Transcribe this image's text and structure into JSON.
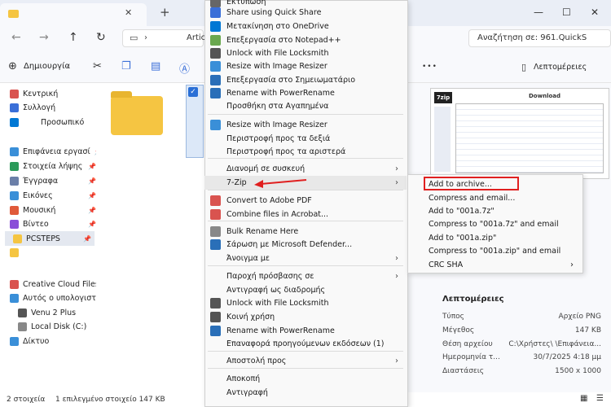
{
  "window": {
    "new_tab_icon": "plus-icon",
    "minimize": "—",
    "maximize": "☐",
    "close": "✕"
  },
  "address": {
    "folder": "Artic",
    "search_placeholder": "Αναζήτηση σε: 961.QuickS"
  },
  "toolbar": {
    "create_label": "Δημιουργία",
    "more": "•••",
    "details_label": "Λεπτομέρειες"
  },
  "sidebar": {
    "items": [
      {
        "label": "Κεντρική",
        "color": "#d9534f"
      },
      {
        "label": "Συλλογή",
        "color": "#3a6fd8"
      },
      {
        "label": "Προσωπικό",
        "color": "#0078d4"
      },
      {
        "label": "Επιφάνεια εργασί",
        "color": "#3a8fd8"
      },
      {
        "label": "Στοιχεία λήψης",
        "color": "#2b9a5a"
      },
      {
        "label": "Έγγραφα",
        "color": "#6b7fa8"
      },
      {
        "label": "Εικόνες",
        "color": "#3a8fd8"
      },
      {
        "label": "Μουσική",
        "color": "#e05a3a"
      },
      {
        "label": "Βίντεο",
        "color": "#8a4fd8"
      },
      {
        "label": "PCSTEPS",
        "color": "#f5c542"
      },
      {
        "label": "",
        "color": "#f5c542"
      },
      {
        "label": "Creative Cloud Files F",
        "color": "#d9534f"
      },
      {
        "label": "Αυτός ο υπολογιστή",
        "color": "#3a8fd8"
      },
      {
        "label": "Venu 2 Plus",
        "color": "#555555"
      },
      {
        "label": "Local Disk (C:)",
        "color": "#888888"
      },
      {
        "label": "Δίκτυο",
        "color": "#3a8fd8"
      }
    ]
  },
  "context_menu": {
    "items": [
      {
        "label": "Εκτύπωση",
        "icon": "printer-icon",
        "color": "#666666"
      },
      {
        "label": "Share using Quick Share",
        "icon": "share-icon",
        "color": "#3a6fd8"
      },
      {
        "label": "Μετακίνηση στο OneDrive",
        "icon": "cloud-icon",
        "color": "#0078d4"
      },
      {
        "label": "Επεξεργασία στο Notepad++",
        "icon": "notepad-icon",
        "color": "#6aa84f"
      },
      {
        "label": "Unlock with File Locksmith",
        "icon": "lock-icon",
        "color": "#555555"
      },
      {
        "label": "Resize with Image Resizer",
        "icon": "resize-icon",
        "color": "#3a8fd8"
      },
      {
        "label": "Επεξεργασία στο Σημειωματάριο",
        "icon": "notepad-icon",
        "color": "#2a6fb8"
      },
      {
        "label": "Rename with PowerRename",
        "icon": "rename-icon",
        "color": "#2a6fb8"
      },
      {
        "label": "Προσθήκη στα Αγαπημένα",
        "icon": "",
        "color": ""
      },
      {
        "label": "Resize with Image Resizer",
        "icon": "resize-icon",
        "color": "#3a8fd8"
      },
      {
        "label": "Περιστροφή προς τα δεξιά",
        "icon": "",
        "color": ""
      },
      {
        "label": "Περιστροφή προς τα αριστερά",
        "icon": "",
        "color": ""
      },
      {
        "label": "Διανομή σε συσκευή",
        "icon": "",
        "color": "",
        "arrow": "›"
      },
      {
        "label": "7-Zip",
        "icon": "",
        "color": "",
        "arrow": "›"
      },
      {
        "label": "Convert to Adobe PDF",
        "icon": "pdf-icon",
        "color": "#d9534f"
      },
      {
        "label": "Combine files in Acrobat...",
        "icon": "acrobat-icon",
        "color": "#d9534f"
      },
      {
        "label": "Bulk Rename Here",
        "icon": "rename-icon",
        "color": "#888888"
      },
      {
        "label": "Σάρωση με Microsoft Defender...",
        "icon": "shield-icon",
        "color": "#2a6fb8"
      },
      {
        "label": "Άνοιγμα με",
        "icon": "",
        "color": "",
        "arrow": "›"
      },
      {
        "label": "Παροχή πρόσβασης σε",
        "icon": "",
        "color": "",
        "arrow": "›"
      },
      {
        "label": "Αντιγραφή ως διαδρομής",
        "icon": "",
        "color": ""
      },
      {
        "label": "Unlock with File Locksmith",
        "icon": "lock-icon",
        "color": "#555555"
      },
      {
        "label": "Κοινή χρήση",
        "icon": "share-icon",
        "color": "#555555"
      },
      {
        "label": "Rename with PowerRename",
        "icon": "rename-icon",
        "color": "#2a6fb8"
      },
      {
        "label": "Επαναφορά προηγούμενων εκδόσεων (1)",
        "icon": "",
        "color": ""
      },
      {
        "label": "Αποστολή προς",
        "icon": "",
        "color": "",
        "arrow": "›"
      },
      {
        "label": "Αποκοπή",
        "icon": "",
        "color": ""
      },
      {
        "label": "Αντιγραφή",
        "icon": "",
        "color": ""
      }
    ]
  },
  "submenu": {
    "items": [
      {
        "label": "Add to archive..."
      },
      {
        "label": "Compress and email..."
      },
      {
        "label": "Add to \"001a.7z\""
      },
      {
        "label": "Compress to \"001a.7z\" and email"
      },
      {
        "label": "Add to \"001a.zip\""
      },
      {
        "label": "Compress to \"001a.zip\" and email"
      },
      {
        "label": "CRC SHA",
        "arrow": "›"
      }
    ]
  },
  "preview": {
    "heading": "Download",
    "logo": "7zip"
  },
  "details": {
    "title": "Λεπτομέρειες",
    "rows": [
      {
        "key": "Τύπος",
        "value": "Αρχείο PNG"
      },
      {
        "key": "Μέγεθος",
        "value": "147 KB"
      },
      {
        "key": "Θέση αρχείου",
        "value": "C:\\Χρήστες\\      \\Επιφάνεια..."
      },
      {
        "key": "Ημερομηνία τ...",
        "value": "30/7/2025 4:18 μμ"
      },
      {
        "key": "Διαστάσεις",
        "value": "1500 x 1000"
      }
    ]
  },
  "status": {
    "count": "2 στοιχεία",
    "selected": "1 επιλεγμένο στοιχείο 147 KB"
  },
  "colors": {
    "accent": "#2a6fd6",
    "highlight": "#e02020"
  }
}
